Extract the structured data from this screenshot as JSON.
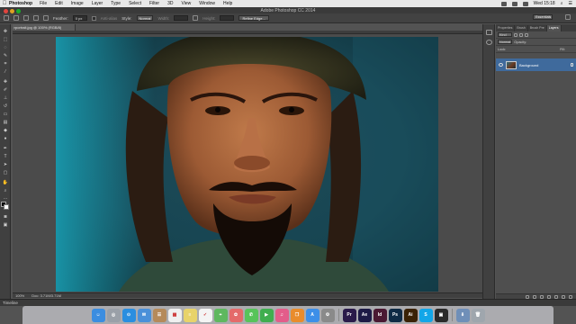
{
  "menubar": {
    "app_name": "Photoshop",
    "items": [
      "File",
      "Edit",
      "Image",
      "Layer",
      "Type",
      "Select",
      "Filter",
      "3D",
      "View",
      "Window",
      "Help"
    ],
    "clock": "Wed 15:18"
  },
  "title": "Adobe Photoshop CC 2014",
  "options": {
    "feather_label": "Feather:",
    "feather_value": "0 px",
    "antialias_label": "Anti-alias",
    "style_label": "Style:",
    "style_value": "Normal",
    "width_label": "Width:",
    "height_label": "Height:",
    "refine_edge": "Refine Edge...",
    "workspace": "Essentials"
  },
  "document": {
    "tab": "portrait.jpg @ 100% (RGB/8)",
    "zoom": "100%",
    "doc_info": "Doc: 3.71M/3.71M"
  },
  "panel": {
    "tabs": [
      "Properties",
      "Brush",
      "Brush Pre",
      "Layers"
    ],
    "active_tab": "Layers",
    "kind": "Kind",
    "blend_mode": "Normal",
    "opacity_label": "Opacity:",
    "lock_label": "Lock:",
    "fill_label": "Fill:",
    "layer_name": "Background"
  },
  "timeline_label": "Timeline",
  "dock_apps": [
    {
      "name": "Finder",
      "glyph": "☺",
      "color": "#3b8de0"
    },
    {
      "name": "Launchpad",
      "glyph": "◎",
      "color": "#9aa0a8"
    },
    {
      "name": "Safari",
      "glyph": "⊙",
      "color": "#2a8ee0"
    },
    {
      "name": "Mail",
      "glyph": "✉",
      "color": "#4a90d9"
    },
    {
      "name": "Contacts",
      "glyph": "☰",
      "color": "#b58a5a"
    },
    {
      "name": "Calendar",
      "glyph": "▦",
      "color": "#f0f0f0"
    },
    {
      "name": "Notes",
      "glyph": "≡",
      "color": "#e8d36a"
    },
    {
      "name": "Reminders",
      "glyph": "✓",
      "color": "#f4f4f4"
    },
    {
      "name": "Maps",
      "glyph": "⌖",
      "color": "#5fb85f"
    },
    {
      "name": "Photos",
      "glyph": "✿",
      "color": "#e46a6a"
    },
    {
      "name": "Messages",
      "glyph": "✆",
      "color": "#57c45a"
    },
    {
      "name": "FaceTime",
      "glyph": "▶",
      "color": "#3fae4f"
    },
    {
      "name": "iTunes",
      "glyph": "♫",
      "color": "#e35d8a"
    },
    {
      "name": "iBooks",
      "glyph": "❐",
      "color": "#e98c2c"
    },
    {
      "name": "App Store",
      "glyph": "A",
      "color": "#3d8fe8"
    },
    {
      "name": "System Preferences",
      "glyph": "⚙",
      "color": "#8a8a8a"
    },
    {
      "name": "Premiere",
      "glyph": "Pr",
      "color": "#2a1a4a"
    },
    {
      "name": "After Effects",
      "glyph": "Ae",
      "color": "#1d1a46"
    },
    {
      "name": "InDesign",
      "glyph": "Id",
      "color": "#4a1832"
    },
    {
      "name": "Photoshop",
      "glyph": "Ps",
      "color": "#0f2b45"
    },
    {
      "name": "Illustrator",
      "glyph": "Ai",
      "color": "#3a2205"
    },
    {
      "name": "Skype",
      "glyph": "S",
      "color": "#12a6e8"
    },
    {
      "name": "Terminal",
      "glyph": "▣",
      "color": "#2a2a2a"
    },
    {
      "name": "Downloads",
      "glyph": "⬇",
      "color": "#6f8fb8"
    },
    {
      "name": "Trash",
      "glyph": "🗑",
      "color": "#9fa6ad"
    }
  ]
}
